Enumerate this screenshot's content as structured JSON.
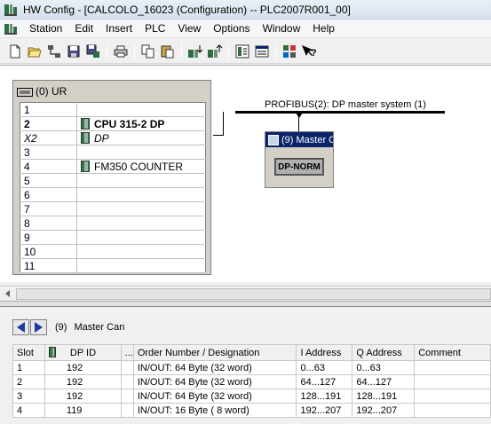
{
  "window": {
    "title": "HW Config - [CALCOLO_16023 (Configuration) -- PLC2007R001_00]"
  },
  "menu": [
    "Station",
    "Edit",
    "Insert",
    "PLC",
    "View",
    "Options",
    "Window",
    "Help"
  ],
  "toolbar": {
    "icons": [
      "new-icon",
      "open-icon",
      "save-icon",
      "save-compile-icon",
      "print-icon",
      "copy-icon",
      "paste-icon",
      "download-icon",
      "upload-icon",
      "module-info-icon",
      "catalog-icon",
      "network-icon",
      "help-icon"
    ]
  },
  "rack": {
    "title": "(0) UR",
    "slots": [
      {
        "slot": "1",
        "module": "",
        "bold": false,
        "italic": false,
        "icon": false
      },
      {
        "slot": "2",
        "module": "CPU 315-2 DP",
        "bold": true,
        "italic": false,
        "icon": true
      },
      {
        "slot": "X2",
        "module": "DP",
        "bold": false,
        "italic": true,
        "icon": true
      },
      {
        "slot": "3",
        "module": "",
        "bold": false,
        "italic": false,
        "icon": false
      },
      {
        "slot": "4",
        "module": "FM350 COUNTER",
        "bold": false,
        "italic": false,
        "icon": true
      },
      {
        "slot": "5",
        "module": "",
        "bold": false,
        "italic": false,
        "icon": false
      },
      {
        "slot": "6",
        "module": "",
        "bold": false,
        "italic": false,
        "icon": false
      },
      {
        "slot": "7",
        "module": "",
        "bold": false,
        "italic": false,
        "icon": false
      },
      {
        "slot": "8",
        "module": "",
        "bold": false,
        "italic": false,
        "icon": false
      },
      {
        "slot": "9",
        "module": "",
        "bold": false,
        "italic": false,
        "icon": false
      },
      {
        "slot": "10",
        "module": "",
        "bold": false,
        "italic": false,
        "icon": false
      },
      {
        "slot": "11",
        "module": "",
        "bold": false,
        "italic": false,
        "icon": false
      }
    ]
  },
  "bus": {
    "label": "PROFIBUS(2): DP master system (1)"
  },
  "slave": {
    "title": "(9) Master C",
    "button": "DP-NORM"
  },
  "detail": {
    "nav_number": "(9)",
    "nav_name": "Master Can",
    "columns": [
      "Slot",
      "DP ID",
      "...",
      "Order Number / Designation",
      "I Address",
      "Q Address",
      "Comment"
    ],
    "rows": [
      {
        "slot": "1",
        "dpid": "192",
        "designation": "IN/OUT:  64 Byte (32 word)",
        "iaddr": "0...63",
        "qaddr": "0...63",
        "comment": ""
      },
      {
        "slot": "2",
        "dpid": "192",
        "designation": "IN/OUT:  64 Byte (32 word)",
        "iaddr": "64...127",
        "qaddr": "64...127",
        "comment": ""
      },
      {
        "slot": "3",
        "dpid": "192",
        "designation": "IN/OUT:  64 Byte (32 word)",
        "iaddr": "128...191",
        "qaddr": "128...191",
        "comment": ""
      },
      {
        "slot": "4",
        "dpid": "119",
        "designation": "IN/OUT:  16 Byte ( 8 word)",
        "iaddr": "192...207",
        "qaddr": "192...207",
        "comment": ""
      }
    ]
  }
}
